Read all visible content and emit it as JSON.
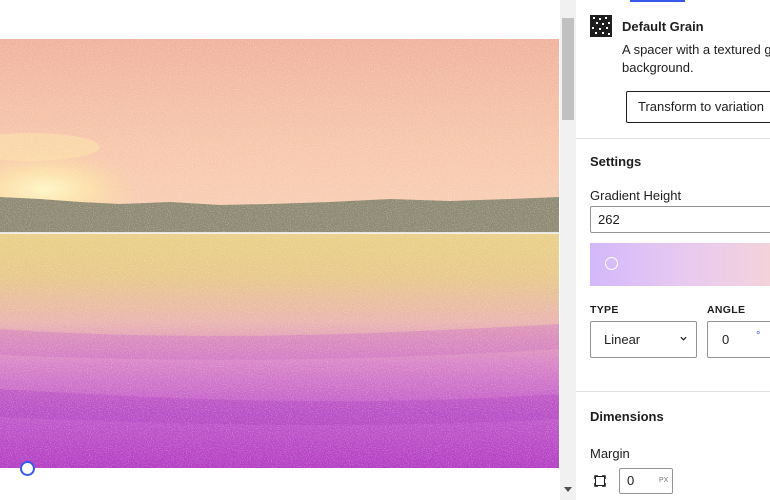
{
  "block": {
    "title": "Default Grain",
    "description": "A spacer with a textured gradient background.",
    "transform_label": "Transform to variation",
    "icon": "grain-texture-icon"
  },
  "settings": {
    "heading": "Settings",
    "gradient_height_label": "Gradient Height",
    "gradient_height_value": "262",
    "gradient_colors": [
      "#d3b8fb",
      "#f5d3d8"
    ],
    "type_label": "TYPE",
    "type_value": "Linear",
    "angle_label": "ANGLE",
    "angle_value": "0",
    "angle_unit": "°"
  },
  "dimensions": {
    "heading": "Dimensions",
    "margin_label": "Margin",
    "margin_value": "0",
    "margin_unit": "PX"
  },
  "colors": {
    "accent": "#3858e9",
    "sky": "#f5c2a8",
    "water_top": "#e9c770",
    "water_bottom": "#b040c0"
  }
}
